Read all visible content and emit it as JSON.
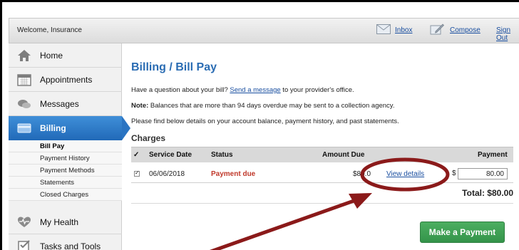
{
  "topbar": {
    "welcome": "Welcome, Insurance",
    "inbox": "Inbox",
    "compose": "Compose",
    "sign_out": "Sign Out"
  },
  "sidebar": {
    "items": [
      {
        "label": "Home",
        "icon": "home-icon"
      },
      {
        "label": "Appointments",
        "icon": "calendar-icon"
      },
      {
        "label": "Messages",
        "icon": "chat-bubbles-icon"
      },
      {
        "label": "Billing",
        "icon": "billing-card-icon",
        "active": true
      },
      {
        "label": "My Health",
        "icon": "heart-pulse-icon"
      },
      {
        "label": "Tasks and Tools",
        "icon": "checklist-icon"
      }
    ],
    "billing_sub": [
      "Bill Pay",
      "Payment History",
      "Payment Methods",
      "Statements",
      "Closed Charges"
    ]
  },
  "main": {
    "title": "Billing / Bill Pay",
    "question_pre": "Have a question about your bill? ",
    "question_link": "Send a message",
    "question_post": " to your provider's office.",
    "note_label": "Note:",
    "note_text": " Balances that are more than 94 days overdue may be sent to a collection agency.",
    "details_text": "Please find below details on your account balance, payment history, and past statements.",
    "section_title": "Charges",
    "columns": {
      "check": "✓",
      "service_date": "Service Date",
      "status": "Status",
      "amount_due": "Amount Due",
      "payment": "Payment"
    },
    "rows": [
      {
        "service_date": "06/06/2018",
        "status": "Payment due",
        "amount_due": "$80.0",
        "view_details": "View details",
        "currency": "$",
        "payment": "80.00"
      }
    ],
    "total_label": "Total:",
    "total_value": "$80.00",
    "pay_button": "Make a Payment"
  },
  "colors": {
    "accent_blue": "#2a6cb3",
    "status_due": "#c0392b",
    "button_green": "#3fa055",
    "annotation_red": "#8b1a1a"
  }
}
